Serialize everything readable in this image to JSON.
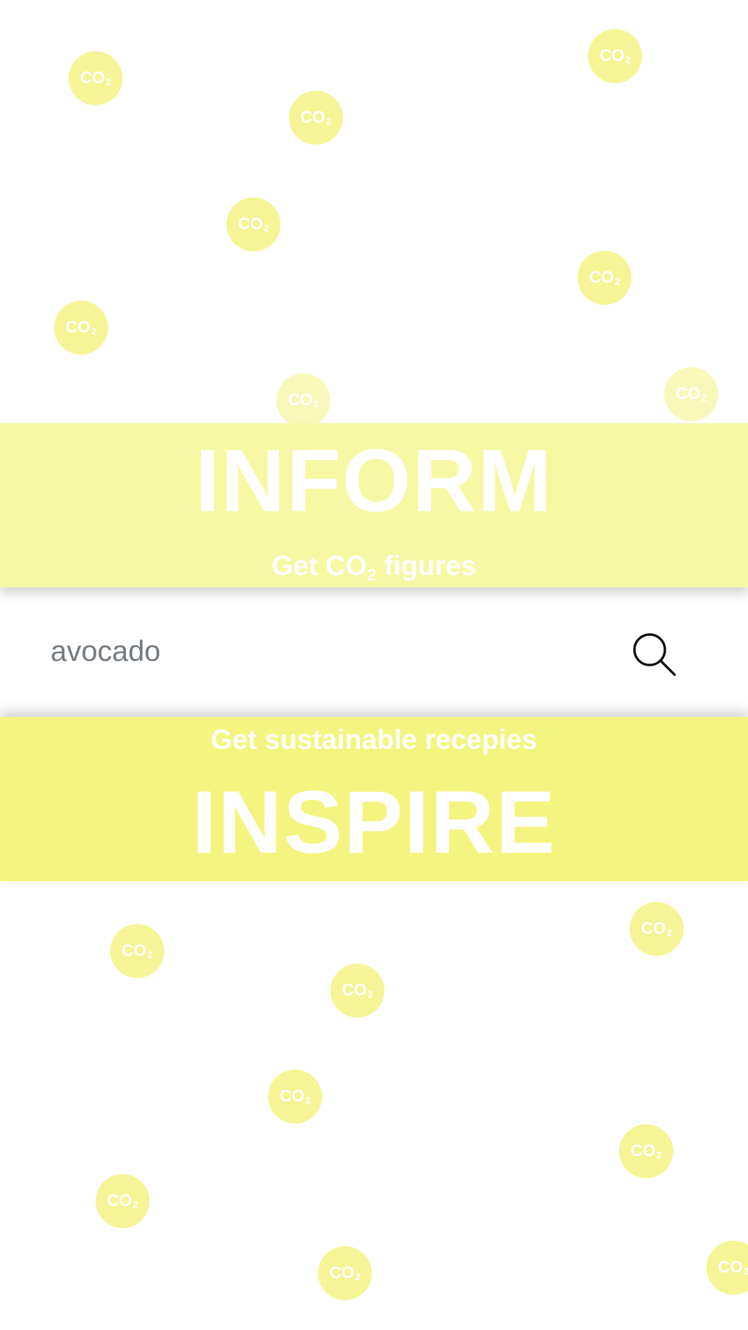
{
  "bubble": {
    "label": "CO",
    "subscript": "2"
  },
  "inform": {
    "title": "INFORM",
    "subtitle_prefix": "Get CO",
    "subtitle_subscript": "2",
    "subtitle_suffix": " figures"
  },
  "search": {
    "value": "avocado",
    "icon": "search-icon"
  },
  "inspire": {
    "subtitle": "Get sustainable recepies",
    "title": "INSPIRE"
  },
  "colors": {
    "bubble": "#f5f58f",
    "inform_banner": "#f7f8a4",
    "inspire_banner": "#f4f580",
    "banner_text": "#ffffff",
    "search_text": "#747a80"
  }
}
